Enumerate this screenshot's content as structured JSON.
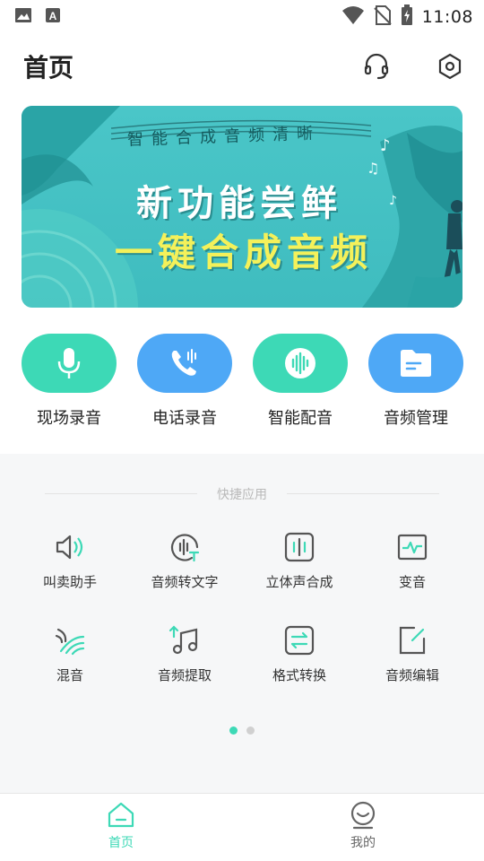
{
  "status_bar": {
    "time": "11:08",
    "icons": [
      "image-icon",
      "a-icon",
      "wifi-icon",
      "no-sim-icon",
      "battery-charging-icon"
    ]
  },
  "header": {
    "title": "首页",
    "support_icon": "headset-icon",
    "settings_icon": "hexagon-settings-icon"
  },
  "banner": {
    "subtitle": "智能合成音频清晰",
    "line1": "新功能尝鲜",
    "line2": "一键合成音频"
  },
  "main_actions": [
    {
      "label": "现场录音",
      "icon": "microphone-icon",
      "color": "#3dd9b6"
    },
    {
      "label": "电话录音",
      "icon": "phone-icon",
      "color": "#4ea8f6"
    },
    {
      "label": "智能配音",
      "icon": "audio-wave-icon",
      "color": "#3dd9b6"
    },
    {
      "label": "音频管理",
      "icon": "folder-icon",
      "color": "#4ea8f6"
    }
  ],
  "quick_apps": {
    "title": "快捷应用",
    "items": [
      {
        "label": "叫卖助手",
        "icon": "speaker-icon"
      },
      {
        "label": "音频转文字",
        "icon": "audio-to-text-icon"
      },
      {
        "label": "立体声合成",
        "icon": "stereo-icon"
      },
      {
        "label": "变音",
        "icon": "voice-change-icon"
      },
      {
        "label": "混音",
        "icon": "mix-icon"
      },
      {
        "label": "音频提取",
        "icon": "extract-icon"
      },
      {
        "label": "格式转换",
        "icon": "convert-icon"
      },
      {
        "label": "音频编辑",
        "icon": "edit-icon"
      }
    ],
    "page_indicator": {
      "current": 1,
      "total": 2
    }
  },
  "tabbar": {
    "tabs": [
      {
        "label": "首页",
        "icon": "home-icon",
        "active": true
      },
      {
        "label": "我的",
        "icon": "profile-icon",
        "active": false
      }
    ],
    "active_color": "#3dd9b6",
    "inactive_color": "#666666"
  },
  "colors": {
    "accent_green": "#3dd9b6",
    "accent_blue": "#4ea8f6",
    "icon_gray": "#555555"
  }
}
